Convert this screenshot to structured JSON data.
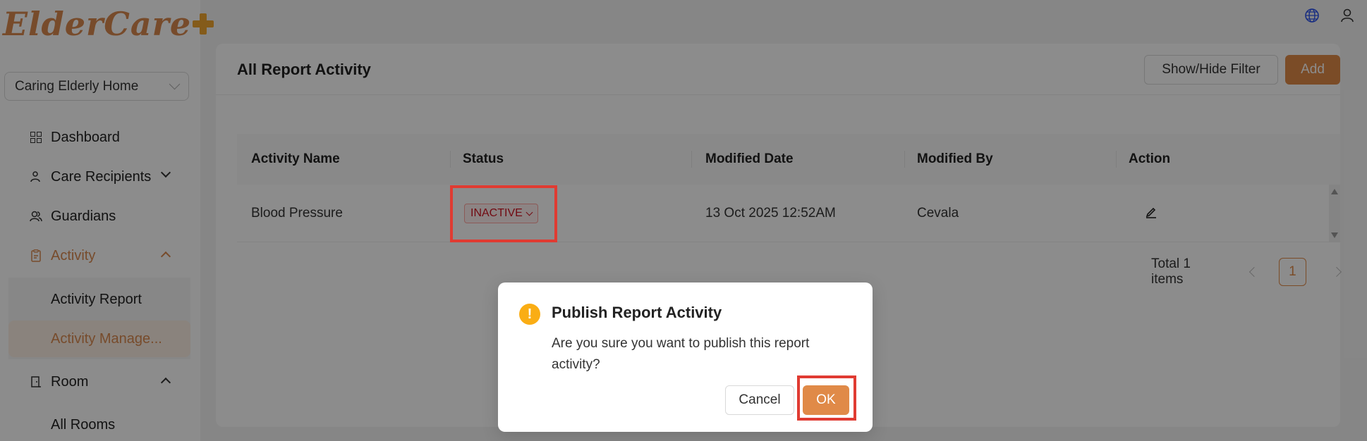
{
  "app": {
    "logo_text": "ElderCare",
    "brand_color": "#e08a48",
    "plus_color": "#f0a630"
  },
  "sidebar": {
    "home_select": "Caring Elderly Home",
    "items": [
      {
        "label": "Dashboard",
        "icon": "dashboard-icon"
      },
      {
        "label": "Care Recipients",
        "icon": "care-recipients-icon",
        "expanded": false
      },
      {
        "label": "Guardians",
        "icon": "guardians-icon"
      },
      {
        "label": "Activity",
        "icon": "activity-icon",
        "expanded": true,
        "active": true
      },
      {
        "label": "Room",
        "icon": "room-icon",
        "expanded": true
      }
    ],
    "activity_sub": [
      {
        "label": "Activity Report"
      },
      {
        "label": "Activity Manage...",
        "selected": true
      }
    ],
    "room_sub": [
      {
        "label": "All Rooms"
      }
    ]
  },
  "topbar": {
    "icons": [
      "globe-icon",
      "user-icon"
    ]
  },
  "main": {
    "title": "All Report Activity",
    "filter_button": "Show/Hide Filter",
    "add_button": "Add",
    "table": {
      "columns": [
        "Activity Name",
        "Status",
        "Modified Date",
        "Modified By",
        "Action"
      ],
      "rows": [
        {
          "activity_name": "Blood Pressure",
          "status": "INACTIVE",
          "modified_date": "13 Oct 2025 12:52AM",
          "modified_by": "Cevala",
          "action_icon": "edit-icon"
        }
      ]
    },
    "pagination": {
      "total_text": "Total 1 items",
      "current_page": "1"
    }
  },
  "modal": {
    "title": "Publish Report Activity",
    "message": "Are you sure you want to publish this report activity?",
    "cancel_label": "Cancel",
    "ok_label": "OK",
    "icon": "warning-icon"
  }
}
